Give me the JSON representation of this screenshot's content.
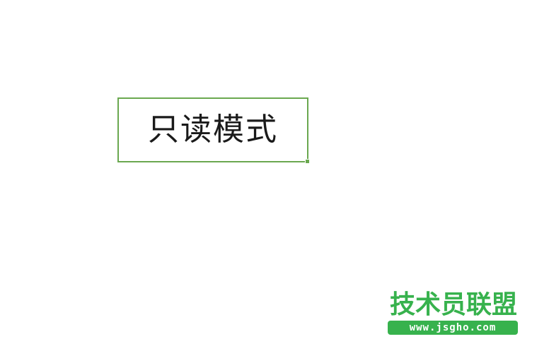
{
  "cell": {
    "text": "只读模式",
    "border_color": "#6aa84f"
  },
  "watermark": {
    "title": "技术员联盟",
    "url": "www.jsgho.com",
    "color": "#37b24d"
  }
}
